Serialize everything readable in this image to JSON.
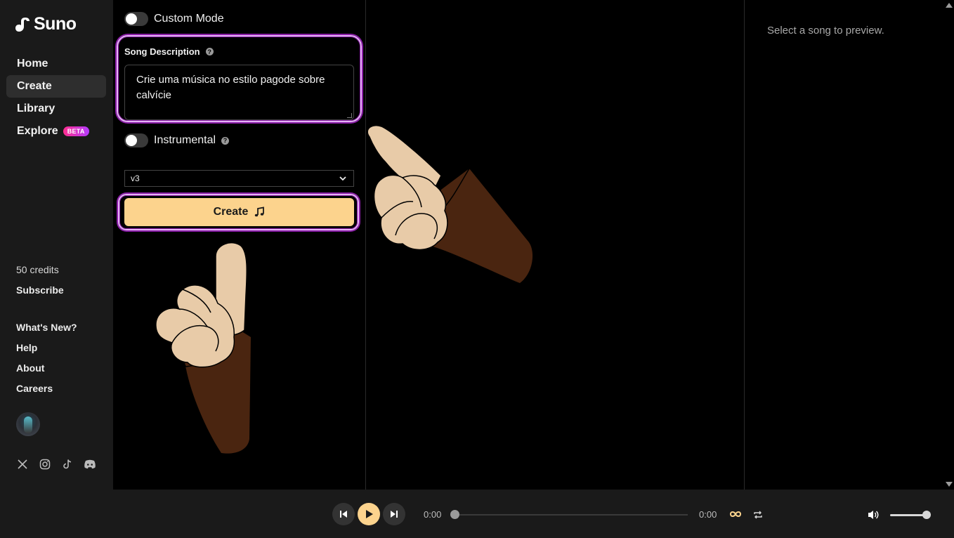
{
  "brand": {
    "name": "Suno"
  },
  "nav": [
    {
      "label": "Home",
      "active": false
    },
    {
      "label": "Create",
      "active": true
    },
    {
      "label": "Library",
      "active": false
    },
    {
      "label": "Explore",
      "active": false,
      "badge": "BETA"
    }
  ],
  "account": {
    "credits": "50 credits",
    "subscribe": "Subscribe"
  },
  "links": [
    "What's New?",
    "Help",
    "About",
    "Careers"
  ],
  "socials": [
    "x-icon",
    "instagram-icon",
    "tiktok-icon",
    "discord-icon"
  ],
  "create": {
    "custom_mode_label": "Custom Mode",
    "custom_mode_on": false,
    "description_label": "Song Description",
    "description_value": "Crie uma música no estilo pagode sobre calvície",
    "instrumental_label": "Instrumental",
    "instrumental_on": false,
    "model_value": "v3",
    "create_button": "Create"
  },
  "preview": {
    "placeholder": "Select a song to preview."
  },
  "player": {
    "current_time": "0:00",
    "duration": "0:00",
    "progress": 0,
    "volume": 1.0
  },
  "colors": {
    "accent": "#fcd38d",
    "highlight": "#8b1fa8",
    "sidebar_bg": "#1a1a1a",
    "badge_start": "#ff2e8f",
    "badge_end": "#b43bff"
  }
}
